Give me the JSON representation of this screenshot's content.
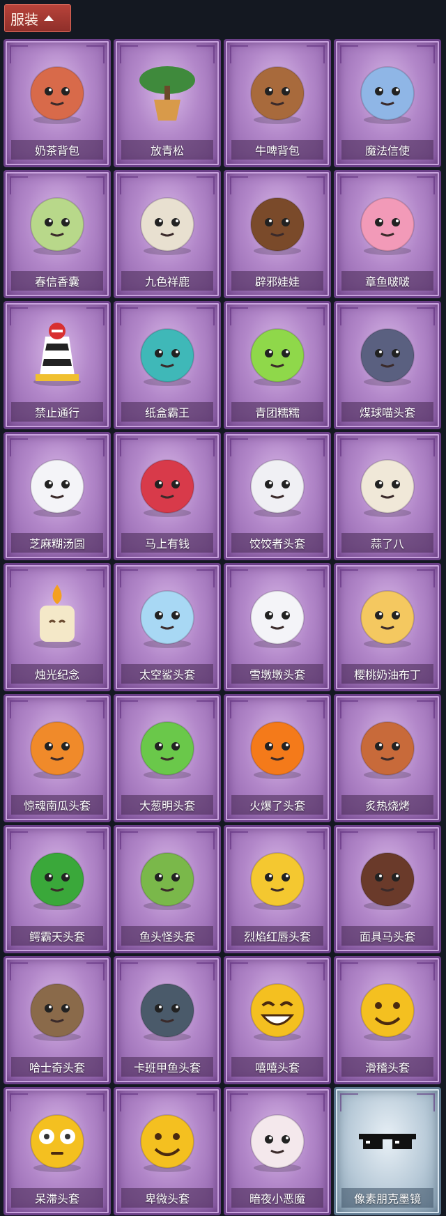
{
  "header": {
    "label": "服装",
    "expand_icon": "chevron-up-icon"
  },
  "items": [
    {
      "name": "奶茶背包",
      "icon": "milk-tea-backpack-icon",
      "color": "#d86a4a"
    },
    {
      "name": "放青松",
      "icon": "bonsai-pine-icon",
      "color": "#3f8a3c"
    },
    {
      "name": "牛啤背包",
      "icon": "cow-beer-backpack-icon",
      "color": "#a86a3c"
    },
    {
      "name": "魔法信使",
      "icon": "blue-elephant-icon",
      "color": "#8fb6e6"
    },
    {
      "name": "春信香囊",
      "icon": "sachet-icon",
      "color": "#b8d88a"
    },
    {
      "name": "九色祥鹿",
      "icon": "deer-icon",
      "color": "#e8e0d0"
    },
    {
      "name": "辟邪娃娃",
      "icon": "doll-head-icon",
      "color": "#7a4a2a"
    },
    {
      "name": "章鱼啵啵",
      "icon": "pink-octopus-icon",
      "color": "#f29ab8"
    },
    {
      "name": "禁止通行",
      "icon": "road-barrier-icon",
      "color": "#f0c030"
    },
    {
      "name": "纸盒霸王",
      "icon": "box-dinosaur-icon",
      "color": "#3fb8b8"
    },
    {
      "name": "青团糯糯",
      "icon": "green-dumpling-icon",
      "color": "#8fd84a"
    },
    {
      "name": "煤球喵头套",
      "icon": "gray-cat-head-icon",
      "color": "#5a6080"
    },
    {
      "name": "芝麻糊汤圆",
      "icon": "white-rice-ball-icon",
      "color": "#f4f4f8"
    },
    {
      "name": "马上有钱",
      "icon": "red-horse-head-icon",
      "color": "#d83a4a"
    },
    {
      "name": "饺饺者头套",
      "icon": "dumpling-head-icon",
      "color": "#f0f0f4"
    },
    {
      "name": "蒜了八",
      "icon": "garlic-icon",
      "color": "#f0e8d8"
    },
    {
      "name": "烛光纪念",
      "icon": "candle-icon",
      "color": "#f4e8c8"
    },
    {
      "name": "太空鲨头套",
      "icon": "shark-head-icon",
      "color": "#a8d8f4"
    },
    {
      "name": "雪墩墩头套",
      "icon": "snowman-head-icon",
      "color": "#f4f4f8"
    },
    {
      "name": "樱桃奶油布丁",
      "icon": "pudding-icon",
      "color": "#f4c860"
    },
    {
      "name": "惊魂南瓜头套",
      "icon": "pumpkin-head-icon",
      "color": "#f08a2a"
    },
    {
      "name": "大葱明头套",
      "icon": "green-onion-head-icon",
      "color": "#6ac84a"
    },
    {
      "name": "火爆了头套",
      "icon": "fire-head-icon",
      "color": "#f47a1a"
    },
    {
      "name": "炙热烧烤",
      "icon": "bbq-meat-icon",
      "color": "#c86a3a"
    },
    {
      "name": "鳄霸天头套",
      "icon": "crocodile-head-icon",
      "color": "#3aa83a"
    },
    {
      "name": "鱼头怪头套",
      "icon": "fish-head-icon",
      "color": "#7ab84a"
    },
    {
      "name": "烈焰红唇头套",
      "icon": "yellow-mouse-sunglasses-icon",
      "color": "#f4c830"
    },
    {
      "name": "面具马头套",
      "icon": "horse-mask-icon",
      "color": "#6a3a2a"
    },
    {
      "name": "哈士奇头套",
      "icon": "husky-sunglasses-icon",
      "color": "#8a6a4a"
    },
    {
      "name": "卡班甲鱼头套",
      "icon": "whale-head-icon",
      "color": "#4a5a6a"
    },
    {
      "name": "嘻嘻头套",
      "icon": "grin-emoji-icon",
      "color": "#f4c020"
    },
    {
      "name": "滑稽头套",
      "icon": "smirk-emoji-icon",
      "color": "#f4c020"
    },
    {
      "name": "呆滞头套",
      "icon": "dazed-emoji-icon",
      "color": "#f4c020"
    },
    {
      "name": "卑微头套",
      "icon": "humble-emoji-icon",
      "color": "#f4c020"
    },
    {
      "name": "暗夜小恶魔",
      "icon": "little-devil-icon",
      "color": "#f4e8ec"
    },
    {
      "name": "像素朋克墨镜",
      "icon": "pixel-sunglasses-icon",
      "color": "#111111",
      "special": true
    }
  ]
}
